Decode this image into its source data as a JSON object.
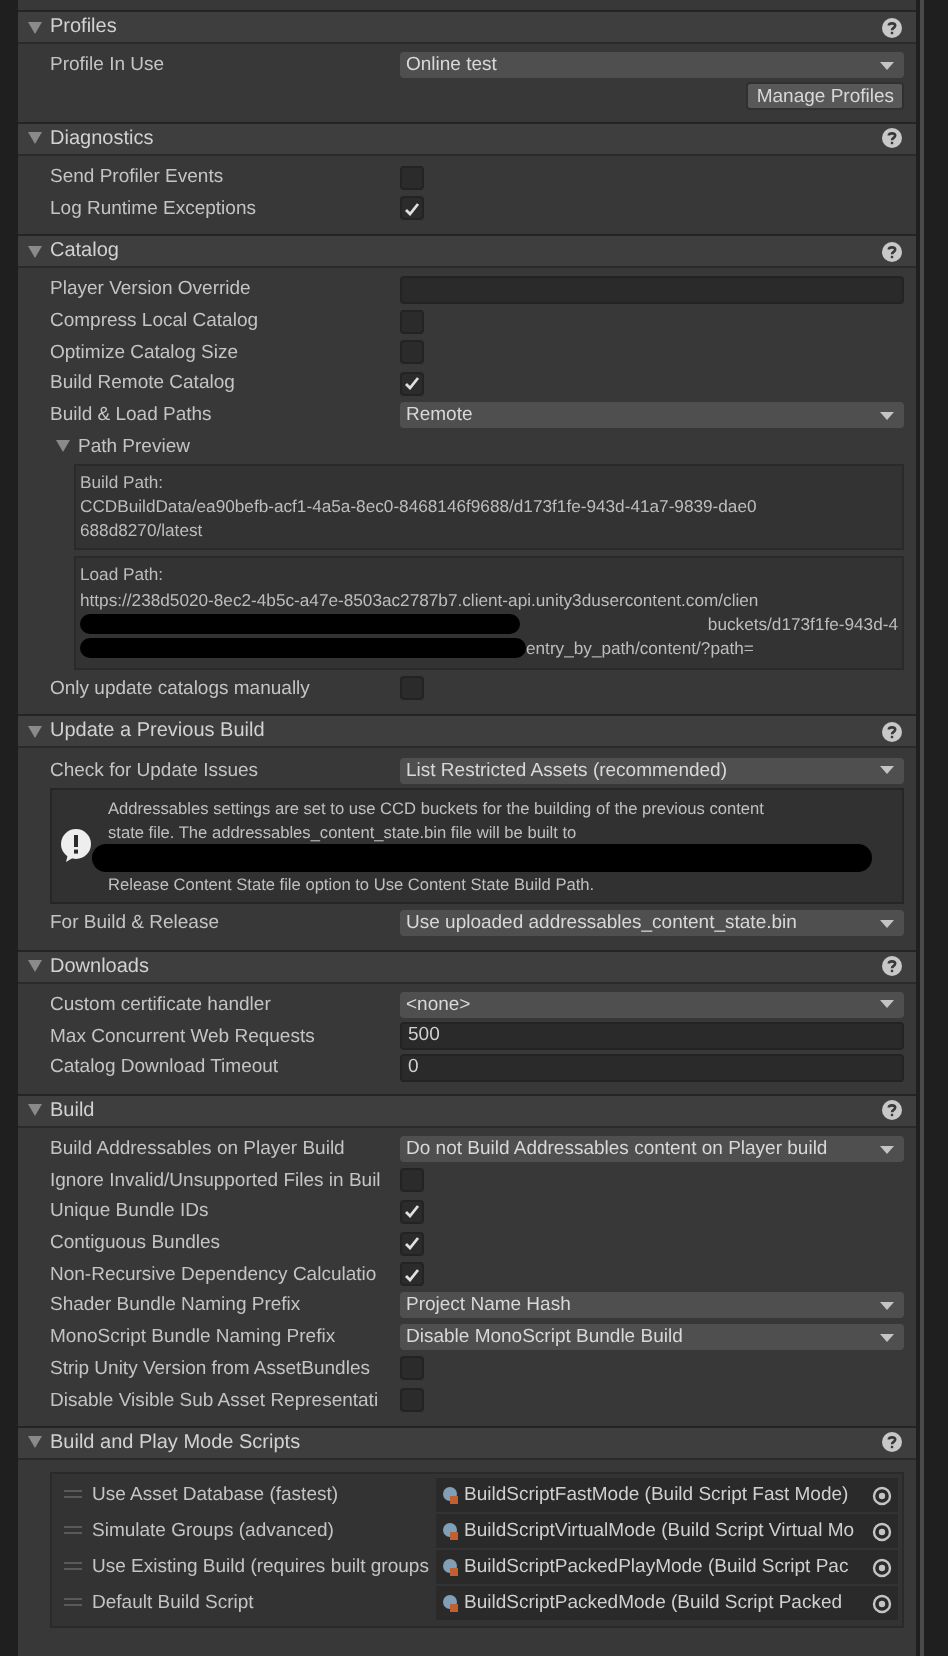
{
  "sections": [
    {
      "title": "Profiles",
      "expanded": true,
      "rows": [
        {
          "kind": "dropdown",
          "label": "Profile In Use",
          "value": "Online test"
        },
        {
          "kind": "button",
          "label": "Manage Profiles"
        }
      ]
    },
    {
      "title": "Diagnostics",
      "expanded": true,
      "rows": [
        {
          "kind": "checkbox",
          "label": "Send Profiler Events",
          "checked": false
        },
        {
          "kind": "checkbox",
          "label": "Log Runtime Exceptions",
          "checked": true
        }
      ]
    },
    {
      "title": "Catalog",
      "expanded": true,
      "rows": [
        {
          "kind": "field",
          "label": "Player Version Override"
        },
        {
          "kind": "checkbox",
          "label": "Compress Local Catalog",
          "checked": false
        },
        {
          "kind": "checkbox",
          "label": "Optimize Catalog Size",
          "checked": false
        },
        {
          "kind": "checkbox",
          "label": "Build Remote Catalog",
          "checked": true
        },
        {
          "kind": "dropdown",
          "label": "Build & Load Paths",
          "value": "Remote"
        },
        {
          "kind": "foldout",
          "label": "Path Preview",
          "expanded": true,
          "boxes": [
            {
              "lines": [
                {
                  "text": "Build Path:",
                  "redacted": false
                },
                {
                  "text": "CCDBuildData/ea90befb-acf1-4a5a-8ec0-8468146f9688/d173f1fe-943d-41a7-9839-dae0",
                  "redacted": false
                },
                {
                  "text": "688d8270/latest",
                  "redacted": false
                }
              ]
            },
            {
              "lines": [
                {
                  "text": "Load Path:",
                  "redacted": false
                },
                {
                  "text": "https://238d5020-8ec2-4b5c-a47e-8503ac2787b7.client-api.unity3dusercontent.com/clien",
                  "redacted": false
                },
                {
                  "text": "buckets/d173f1fe-943d-4",
                  "redacted": true
                },
                {
                  "text": "entry_by_path/content/?path=",
                  "redacted": true
                }
              ]
            }
          ]
        },
        {
          "kind": "checkbox",
          "label": "Only update catalogs manually",
          "checked": false
        }
      ]
    },
    {
      "title": "Update a Previous Build",
      "expanded": true,
      "rows": [
        {
          "kind": "dropdown",
          "label": "Check for Update Issues",
          "value": "List Restricted Assets (recommended)"
        },
        {
          "kind": "helpbox",
          "lines": [
            {
              "text": "Addressables settings are set to use CCD buckets for the building of the previous content",
              "redacted": false
            },
            {
              "text": "state file.  The addressables_content_state.bin file will be built to",
              "redacted": false
            },
            {
              "redacted": true
            },
            {
              "text": "Release Content State file option to Use Content State Build Path.",
              "redacted": false
            }
          ]
        },
        {
          "kind": "dropdown",
          "label": "For Build & Release",
          "value": "Use uploaded addressables_content_state.bin"
        }
      ]
    },
    {
      "title": "Downloads",
      "expanded": true,
      "rows": [
        {
          "kind": "dropdown",
          "label": "Custom certificate handler",
          "value": "<none>"
        },
        {
          "kind": "field",
          "label": "Max Concurrent Web Requests",
          "value": "500"
        },
        {
          "kind": "field",
          "label": "Catalog Download Timeout",
          "value": "0"
        }
      ]
    },
    {
      "title": "Build",
      "expanded": true,
      "rows": [
        {
          "kind": "dropdown",
          "label": "Build Addressables on Player Build",
          "value": "Do not Build Addressables content on Player build"
        },
        {
          "kind": "checkbox",
          "label": "Ignore Invalid/Unsupported Files in Buil",
          "checked": false
        },
        {
          "kind": "checkbox",
          "label": "Unique Bundle IDs",
          "checked": true
        },
        {
          "kind": "checkbox",
          "label": "Contiguous Bundles",
          "checked": true
        },
        {
          "kind": "checkbox",
          "label": "Non-Recursive Dependency Calculatio",
          "checked": true
        },
        {
          "kind": "dropdown",
          "label": "Shader Bundle Naming Prefix",
          "value": "Project Name Hash"
        },
        {
          "kind": "dropdown",
          "label": "MonoScript Bundle Naming Prefix",
          "value": "Disable MonoScript Bundle Build"
        },
        {
          "kind": "checkbox",
          "label": "Strip Unity Version from AssetBundles",
          "checked": false
        },
        {
          "kind": "checkbox",
          "label": "Disable Visible Sub Asset Representati",
          "checked": false
        }
      ]
    },
    {
      "title": "Build and Play Mode Scripts",
      "expanded": true,
      "rows": [
        {
          "kind": "scripts",
          "items": [
            {
              "label": "Use Asset Database (fastest)",
              "value": "BuildScriptFastMode (Build Script Fast Mode)"
            },
            {
              "label": "Simulate Groups (advanced)",
              "value": "BuildScriptVirtualMode (Build Script Virtual Mo"
            },
            {
              "label": "Use Existing Build (requires built groups",
              "value": "BuildScriptPackedPlayMode (Build Script Pac"
            },
            {
              "label": "Default Build Script",
              "value": "BuildScriptPackedMode (Build Script Packed"
            }
          ]
        }
      ]
    }
  ]
}
